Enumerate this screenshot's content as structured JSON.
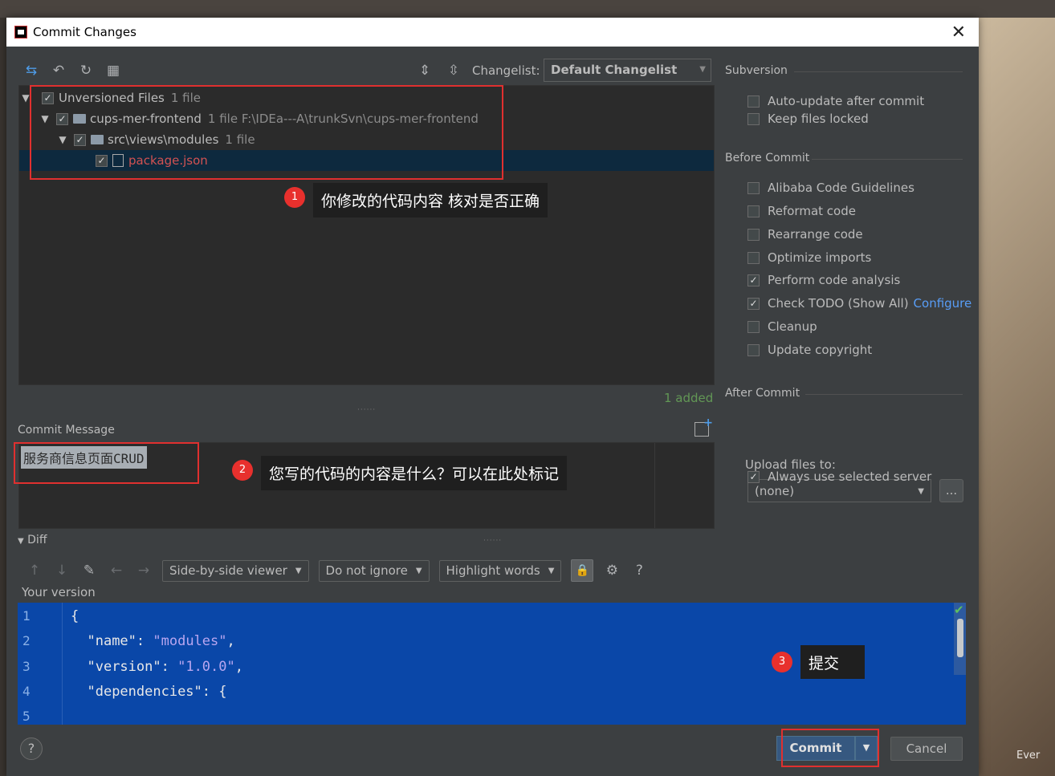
{
  "window": {
    "title": "Commit Changes",
    "close_label": "✕"
  },
  "changelist": {
    "label": "Changelist:",
    "value": "Default Changelist"
  },
  "tree": {
    "root": {
      "label": "Unversioned Files",
      "meta": "1 file"
    },
    "project": {
      "label": "cups-mer-frontend",
      "meta": "1 file  F:\\IDEa---A\\trunkSvn\\cups-mer-frontend"
    },
    "folder": {
      "label": "src\\views\\modules",
      "meta": "1 file"
    },
    "file": {
      "label": "package.json"
    },
    "summary": "1 added"
  },
  "commit_message": {
    "label": "Commit Message",
    "value": "服务商信息页面CRUD"
  },
  "sidebar": {
    "subversion": {
      "title": "Subversion",
      "options": [
        {
          "label": "Auto-update after commit",
          "checked": false
        },
        {
          "label": "Keep files locked",
          "checked": false
        }
      ]
    },
    "before_commit": {
      "title": "Before Commit",
      "options": [
        {
          "label": "Alibaba Code Guidelines",
          "checked": false
        },
        {
          "label": "Reformat code",
          "checked": false
        },
        {
          "label": "Rearrange code",
          "checked": false
        },
        {
          "label": "Optimize imports",
          "checked": false
        },
        {
          "label": "Perform code analysis",
          "checked": true
        },
        {
          "label": "Check TODO (Show All)",
          "checked": true,
          "link": "Configure"
        },
        {
          "label": "Cleanup",
          "checked": false
        },
        {
          "label": "Update copyright",
          "checked": false
        }
      ]
    },
    "after_commit": {
      "title": "After Commit",
      "upload_label": "Upload files to:",
      "server": "(none)",
      "dots": "...",
      "always_use": {
        "label": "Always use selected server",
        "checked": true
      }
    }
  },
  "diff": {
    "label": "Diff",
    "viewer": "Side-by-side viewer",
    "ignore": "Do not ignore",
    "highlight": "Highlight words",
    "help": "?",
    "your_version": "Your version",
    "lines": [
      {
        "n": "1",
        "code": "{"
      },
      {
        "n": "2",
        "key": "\"name\"",
        "value": "\"modules\""
      },
      {
        "n": "3",
        "key": "\"version\"",
        "value": "\"1.0.0\""
      },
      {
        "n": "4",
        "key": "\"dependencies\"",
        "value": "{"
      },
      {
        "n": "5",
        "code": ""
      }
    ]
  },
  "buttons": {
    "help": "?",
    "commit": "Commit",
    "cancel": "Cancel"
  },
  "annotations": {
    "a1": {
      "num": "1",
      "text": "你修改的代码内容 核对是否正确"
    },
    "a2": {
      "num": "2",
      "text": "您写的代码的内容是什么？可以在此处标记"
    },
    "a3": {
      "num": "3",
      "text": "提交"
    }
  },
  "background": {
    "corner_text": "Ever"
  },
  "colors": {
    "accent_link": "#589df6",
    "selection": "#0d293e",
    "editor_bg": "#0a47a8",
    "annotation_red": "#e0302f"
  }
}
